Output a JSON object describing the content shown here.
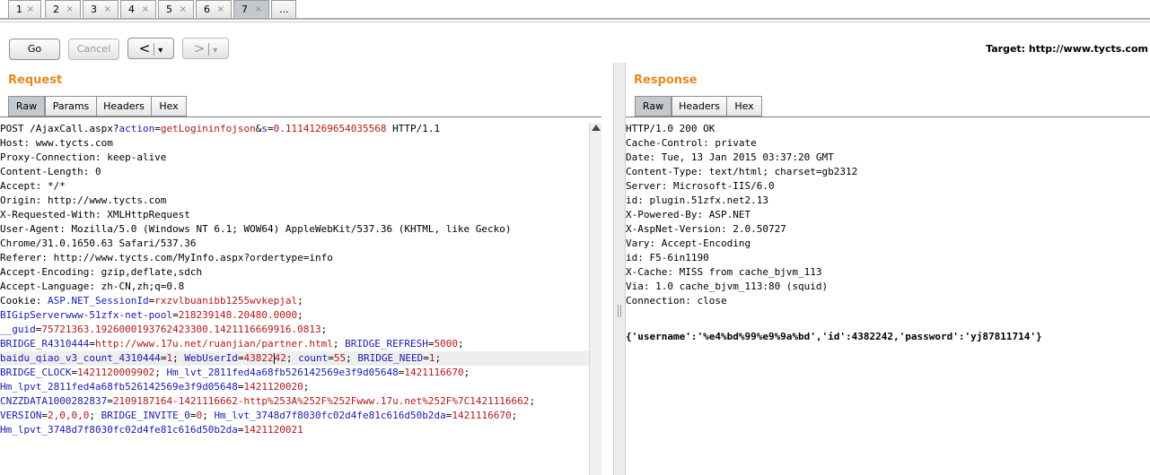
{
  "tabs": [
    {
      "label": "1",
      "close": "×"
    },
    {
      "label": "2",
      "close": "×"
    },
    {
      "label": "3",
      "close": "×"
    },
    {
      "label": "4",
      "close": "×"
    },
    {
      "label": "5",
      "close": "×"
    },
    {
      "label": "6",
      "close": "×"
    },
    {
      "label": "7",
      "close": "×"
    },
    {
      "label": "..."
    }
  ],
  "toolbar": {
    "go": "Go",
    "cancel": "Cancel",
    "back": "<",
    "back_menu": "▾",
    "forward": ">",
    "forward_menu": "▾",
    "target_label": "Target: http://www.tycts.com"
  },
  "request": {
    "title": "Request",
    "tabs": [
      "Raw",
      "Params",
      "Headers",
      "Hex"
    ],
    "lines": [
      [
        [
          "k",
          "POST /AjaxCall.aspx?"
        ],
        [
          "blue",
          "action"
        ],
        [
          "k",
          "="
        ],
        [
          "red",
          "getLogininfojson"
        ],
        [
          "k",
          "&"
        ],
        [
          "blue",
          "s"
        ],
        [
          "k",
          "="
        ],
        [
          "red",
          "0.11141269654035568"
        ],
        [
          "k",
          " HTTP/1.1"
        ]
      ],
      [
        [
          "k",
          "Host: www.tycts.com"
        ]
      ],
      [
        [
          "k",
          "Proxy-Connection: keep-alive"
        ]
      ],
      [
        [
          "k",
          "Content-Length: 0"
        ]
      ],
      [
        [
          "k",
          "Accept: */*"
        ]
      ],
      [
        [
          "k",
          "Origin: http://www.tycts.com"
        ]
      ],
      [
        [
          "k",
          "X-Requested-With: XMLHttpRequest"
        ]
      ],
      [
        [
          "k",
          "User-Agent: Mozilla/5.0 (Windows NT 6.1; WOW64) AppleWebKit/537.36 (KHTML, like Gecko)"
        ]
      ],
      [
        [
          "k",
          "Chrome/31.0.1650.63 Safari/537.36"
        ]
      ],
      [
        [
          "k",
          "Referer: http://www.tycts.com/MyInfo.aspx?ordertype=info"
        ]
      ],
      [
        [
          "k",
          "Accept-Encoding: gzip,deflate,sdch"
        ]
      ],
      [
        [
          "k",
          "Accept-Language: zh-CN,zh;q=0.8"
        ]
      ],
      [
        [
          "k",
          "Cookie: "
        ],
        [
          "blue",
          "ASP.NET_SessionId"
        ],
        [
          "k",
          "="
        ],
        [
          "red",
          "rxzvlbuanibb1255wvkepjal"
        ],
        [
          "k",
          ";"
        ]
      ],
      [
        [
          "blue",
          "BIGipServerwww-51zfx-net-pool"
        ],
        [
          "k",
          "="
        ],
        [
          "red",
          "218239148.20480.0000"
        ],
        [
          "k",
          ";"
        ]
      ],
      [
        [
          "blue",
          "__guid"
        ],
        [
          "k",
          "="
        ],
        [
          "red",
          "75721363.1926000193762423300.1421116669916.0813"
        ],
        [
          "k",
          ";"
        ]
      ],
      [
        [
          "blue",
          "BRIDGE_R4310444"
        ],
        [
          "k",
          "="
        ],
        [
          "red",
          "http://www.17u.net/ruanjian/partner.html"
        ],
        [
          "k",
          "; "
        ],
        [
          "blue",
          "BRIDGE_REFRESH"
        ],
        [
          "k",
          "="
        ],
        [
          "red",
          "5000"
        ],
        [
          "k",
          ";"
        ]
      ],
      [
        [
          "blue",
          "baidu_qiao_v3_count_4310444"
        ],
        [
          "k",
          "="
        ],
        [
          "red",
          "1"
        ],
        [
          "k",
          "; "
        ],
        [
          "blue",
          "WebUserId"
        ],
        [
          "k",
          "="
        ],
        [
          "red",
          "43822"
        ],
        [
          "cursor",
          ""
        ],
        [
          "red",
          "42"
        ],
        [
          "k",
          "; "
        ],
        [
          "blue",
          "count"
        ],
        [
          "k",
          "="
        ],
        [
          "red",
          "55"
        ],
        [
          "k",
          "; "
        ],
        [
          "blue",
          "BRIDGE_NEED"
        ],
        [
          "k",
          "="
        ],
        [
          "red",
          "1"
        ],
        [
          "k",
          ";"
        ]
      ],
      [
        [
          "blue",
          "BRIDGE_CLOCK"
        ],
        [
          "k",
          "="
        ],
        [
          "red",
          "1421120009902"
        ],
        [
          "k",
          "; "
        ],
        [
          "blue",
          "Hm_lvt_2811fed4a68fb526142569e3f9d05648"
        ],
        [
          "k",
          "="
        ],
        [
          "red",
          "1421116670"
        ],
        [
          "k",
          ";"
        ]
      ],
      [
        [
          "blue",
          "Hm_lpvt_2811fed4a68fb526142569e3f9d05648"
        ],
        [
          "k",
          "="
        ],
        [
          "red",
          "1421120020"
        ],
        [
          "k",
          ";"
        ]
      ],
      [
        [
          "blue",
          "CNZZDATA1000282837"
        ],
        [
          "k",
          "="
        ],
        [
          "red",
          "2109187164-1421116662-http%253A%252F%252Fwww.17u.net%252F%7C1421116662"
        ],
        [
          "k",
          ";"
        ]
      ],
      [
        [
          "blue",
          "VERSION"
        ],
        [
          "k",
          "="
        ],
        [
          "red",
          "2,0,0,0"
        ],
        [
          "k",
          "; "
        ],
        [
          "blue",
          "BRIDGE_INVITE_0"
        ],
        [
          "k",
          "="
        ],
        [
          "red",
          "0"
        ],
        [
          "k",
          "; "
        ],
        [
          "blue",
          "Hm_lvt_3748d7f8030fc02d4fe81c616d50b2da"
        ],
        [
          "k",
          "="
        ],
        [
          "red",
          "1421116670"
        ],
        [
          "k",
          ";"
        ]
      ],
      [
        [
          "blue",
          "Hm_lpvt_3748d7f8030fc02d4fe81c616d50b2da"
        ],
        [
          "k",
          "="
        ],
        [
          "red",
          "1421120021"
        ]
      ]
    ]
  },
  "response": {
    "title": "Response",
    "tabs": [
      "Raw",
      "Headers",
      "Hex"
    ],
    "lines": [
      "HTTP/1.0 200 OK",
      "Cache-Control: private",
      "Date: Tue, 13 Jan 2015 03:37:20 GMT",
      "Content-Type: text/html; charset=gb2312",
      "Server: Microsoft-IIS/6.0",
      "id: plugin.51zfx.net2.13",
      "X-Powered-By: ASP.NET",
      "X-AspNet-Version: 2.0.50727",
      "Vary: Accept-Encoding",
      "id: F5-6in1190",
      "X-Cache: MISS from cache_bjvm_113",
      "Via: 1.0 cache_bjvm_113:80 (squid)",
      "Connection: close",
      "",
      "{'username':'%e4%bd%99%e9%9a%bd','id':4382242,'password':'yj87811714'}"
    ]
  }
}
